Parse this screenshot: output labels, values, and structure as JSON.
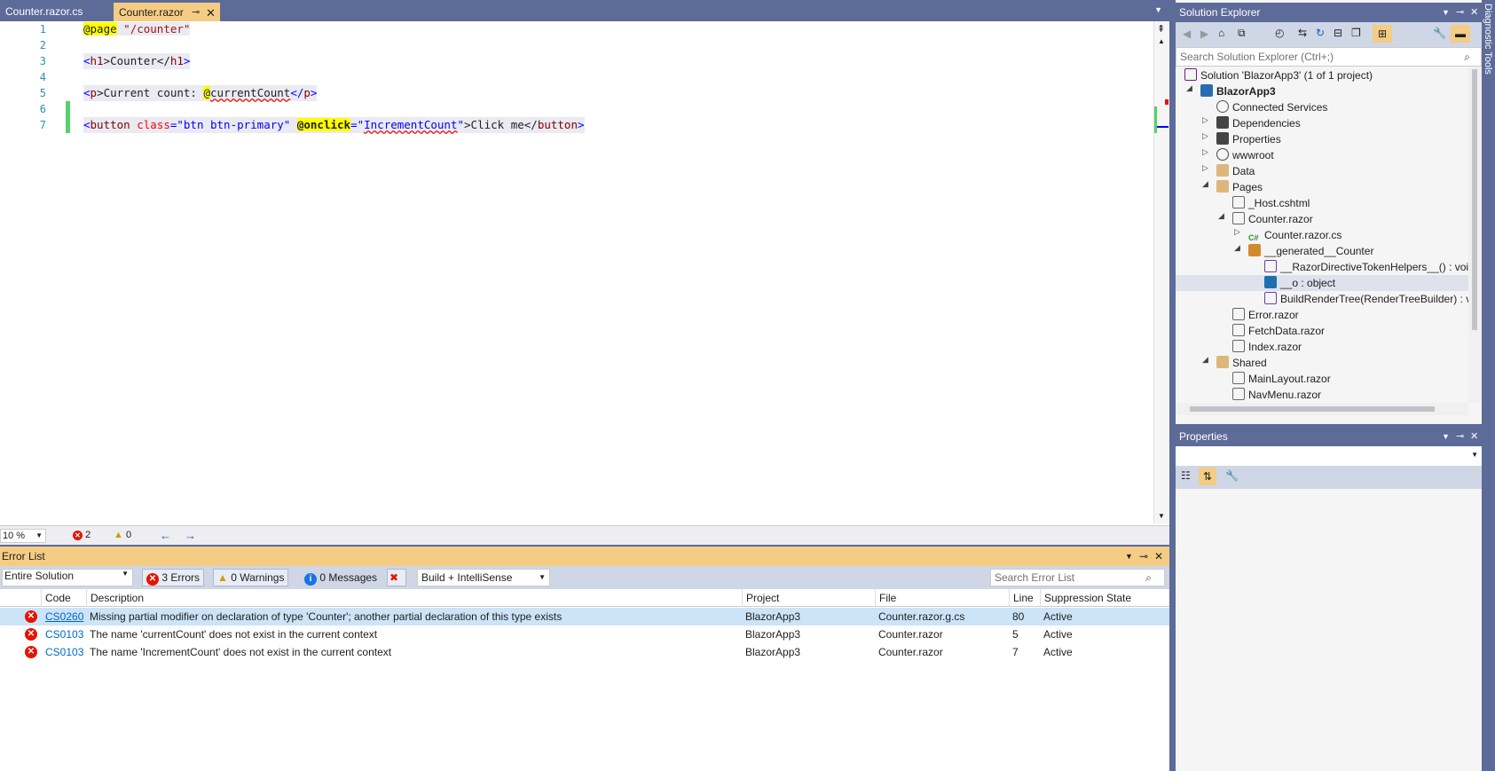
{
  "tabs": [
    {
      "label": "Counter.razor.cs"
    },
    {
      "label": "Counter.razor"
    }
  ],
  "editor": {
    "line_numbers": [
      "1",
      "2",
      "3",
      "4",
      "5",
      "6",
      "7"
    ],
    "l1": {
      "a": "@page",
      "b": " \"/counter\""
    },
    "l3": {
      "a": "<",
      "b": "h1",
      "c": ">Counter</",
      "d": "h1",
      "e": ">"
    },
    "l5": {
      "a": "<",
      "b": "p",
      "c": ">Current count: ",
      "d": "@",
      "e": "currentCount",
      "f": "</",
      "g": "p",
      "h": ">"
    },
    "l7": {
      "a": "<",
      "b": "button",
      "c": " class",
      "d": "=\"btn btn-primary\"",
      "e": " ",
      "f": "@onclick",
      "g": "=\"",
      "h": "IncrementCount",
      "i": "\"",
      "j": ">Click me</",
      "k": "button",
      "l": ">"
    },
    "zoom": "10 %",
    "errors_count": "2",
    "warnings_count": "0"
  },
  "error_list": {
    "title": "Error List",
    "scope": "Entire Solution",
    "errors_btn": "3 Errors",
    "warnings_btn": "0 Warnings",
    "messages_btn": "0 Messages",
    "build_filter": "Build + IntelliSense",
    "search_placeholder": "Search Error List",
    "columns": [
      "Code",
      "Description",
      "Project",
      "File",
      "Line",
      "Suppression State"
    ],
    "rows": [
      {
        "code": "CS0260",
        "desc": "Missing partial modifier on declaration of type 'Counter'; another partial declaration of this type exists",
        "project": "BlazorApp3",
        "file": "Counter.razor.g.cs",
        "line": "80",
        "state": "Active"
      },
      {
        "code": "CS0103",
        "desc": "The name 'currentCount' does not exist in the current context",
        "project": "BlazorApp3",
        "file": "Counter.razor",
        "line": "5",
        "state": "Active"
      },
      {
        "code": "CS0103",
        "desc": "The name 'IncrementCount' does not exist in the current context",
        "project": "BlazorApp3",
        "file": "Counter.razor",
        "line": "7",
        "state": "Active"
      }
    ]
  },
  "solution_explorer": {
    "title": "Solution Explorer",
    "search_placeholder": "Search Solution Explorer (Ctrl+;)",
    "items": [
      "Solution 'BlazorApp3' (1 of 1 project)",
      "BlazorApp3",
      "Connected Services",
      "Dependencies",
      "Properties",
      "wwwroot",
      "Data",
      "Pages",
      "_Host.cshtml",
      "Counter.razor",
      "Counter.razor.cs",
      "__generated__Counter",
      "__RazorDirectiveTokenHelpers__() : void",
      "__o : object",
      "BuildRenderTree(RenderTreeBuilder) : vo",
      "Error.razor",
      "FetchData.razor",
      "Index.razor",
      "Shared",
      "MainLayout.razor",
      "NavMenu.razor"
    ]
  },
  "properties": {
    "title": "Properties"
  },
  "side_tab": "Diagnostic Tools",
  "colors": {
    "accent": "#f5cc84",
    "frame": "#5d6b99",
    "error": "#e51400"
  }
}
